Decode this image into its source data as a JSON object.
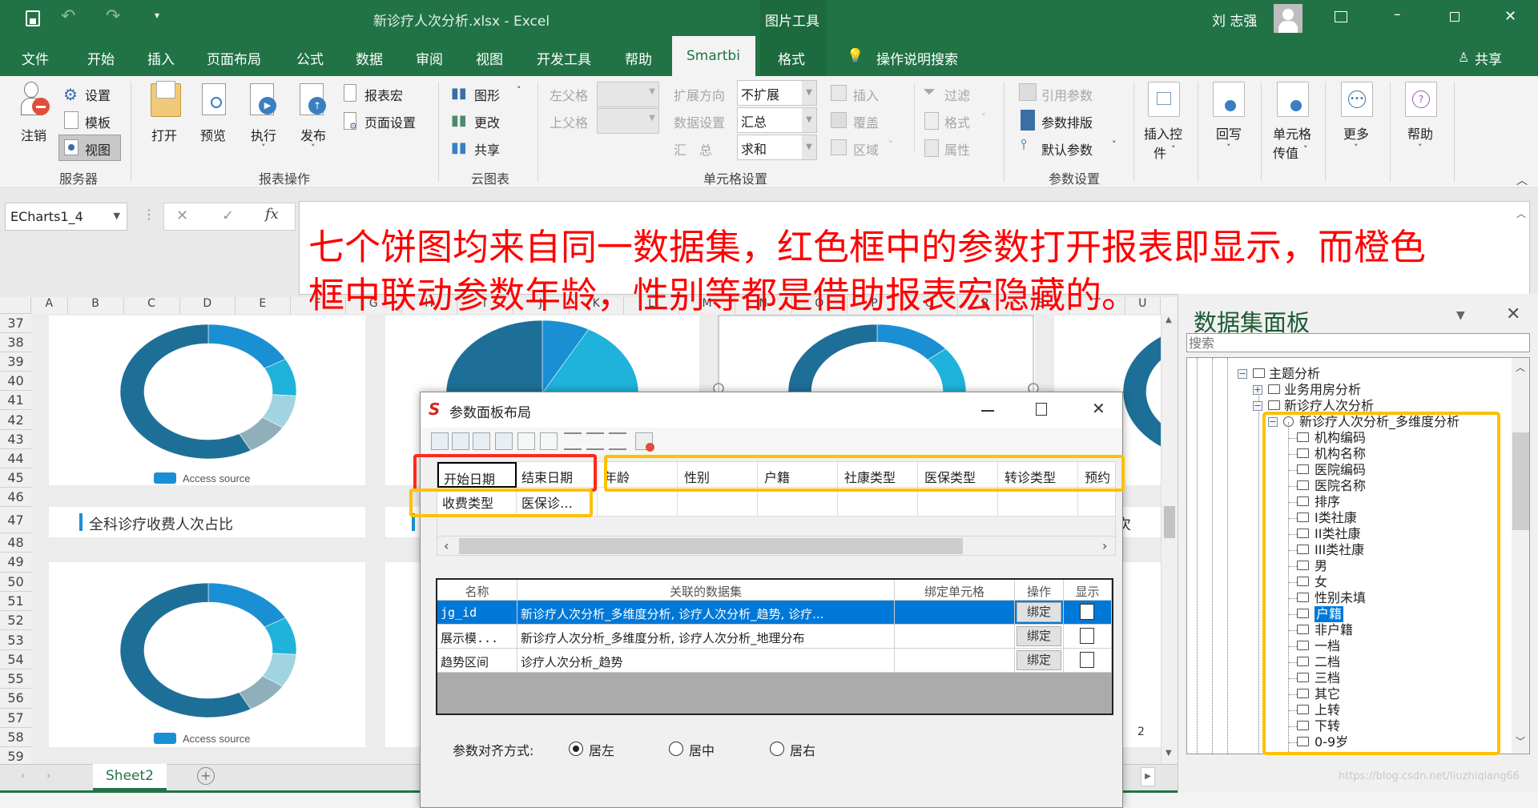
{
  "titlebar": {
    "title": "新诊疗人次分析.xlsx - Excel",
    "context_tool": "图片工具",
    "user": "刘 志强",
    "icons": [
      "save-icon",
      "undo-icon",
      "redo-icon",
      "customize-icon",
      "avatar",
      "ribbon-display-icon",
      "minimize-icon",
      "restore-icon",
      "close-icon"
    ]
  },
  "tabs": [
    "文件",
    "开始",
    "插入",
    "页面布局",
    "公式",
    "数据",
    "审阅",
    "视图",
    "开发工具",
    "帮助",
    "Smartbi",
    "格式"
  ],
  "active_tab": "Smartbi",
  "tell_me": "操作说明搜索",
  "share": "共享",
  "ribbon": {
    "server": {
      "logout": "注销",
      "settings": "设置",
      "template": "模板",
      "view": "视图",
      "label": "服务器"
    },
    "report_ops": {
      "open": "打开",
      "preview": "预览",
      "execute": "执行",
      "publish": "发布",
      "macro": "报表宏",
      "page_setup": "页面设置",
      "label": "报表操作"
    },
    "cloud_chart": {
      "chart": "图形",
      "change": "更改",
      "share": "共享",
      "label": "云图表"
    },
    "cell_settings": {
      "left_parent": "左父格",
      "top_parent": "上父格",
      "expand_dir": "扩展方向",
      "expand_dir_value": "不扩展",
      "data_setting": "数据设置",
      "data_setting_value": "汇总",
      "summary": "汇　总",
      "summary_value": "求和",
      "insert": "插入",
      "cover": "覆盖",
      "area": "区域",
      "filter": "过滤",
      "format": "格式",
      "property": "属性",
      "label": "单元格设置"
    },
    "param_settings": {
      "ref_param": "引用参数",
      "param_layout": "参数排版",
      "default_param": "默认参数",
      "label": "参数设置"
    },
    "insert_control": [
      "插入控",
      "件"
    ],
    "writeback": "回写",
    "cell_pass": [
      "单元格",
      "传值"
    ],
    "more": "更多",
    "help": "帮助"
  },
  "formula_bar": {
    "name_box": "ECharts1_4",
    "cancel": "✕",
    "enter": "✓",
    "fx": "fx"
  },
  "annotation": {
    "line1": "七个饼图均来自同一数据集，红色框中的参数打开报表即显示，而橙色",
    "line2": "框中联动参数年龄，性别等都是借助报表宏隐藏的。",
    "color": "#ff0000"
  },
  "sheet": {
    "columns": [
      "A",
      "B",
      "C",
      "D",
      "E",
      "F",
      "G",
      "H",
      "I",
      "J",
      "K",
      "L",
      "M",
      "N",
      "O",
      "P",
      "Q",
      "R",
      "S",
      "T",
      "U"
    ],
    "rows": [
      "37",
      "38",
      "39",
      "40",
      "41",
      "42",
      "43",
      "44",
      "45",
      "46",
      "47",
      "48",
      "49",
      "50",
      "51",
      "52",
      "53",
      "54",
      "55",
      "56",
      "57",
      "58",
      "59"
    ],
    "card_title_1": "全科诊疗收费人次占比",
    "card_title_4": "人次",
    "axis_tick": "2",
    "sheet_tab": "Sheet2"
  },
  "chart_data": [
    {
      "type": "pie",
      "style": "donut",
      "legend": [
        "Access source"
      ],
      "values": [
        17,
        9,
        8,
        8,
        58
      ]
    },
    {
      "type": "pie",
      "style": "pie",
      "values": [
        8,
        18,
        9,
        8,
        57
      ]
    },
    {
      "type": "pie",
      "style": "donut",
      "values": [
        14,
        12,
        9,
        8,
        57
      ]
    },
    {
      "type": "pie",
      "style": "donut",
      "values": [
        14,
        12,
        9,
        8,
        57
      ]
    },
    {
      "type": "pie",
      "style": "donut",
      "legend": [
        "Access source"
      ],
      "values": [
        17,
        9,
        8,
        8,
        58
      ]
    }
  ],
  "colors": {
    "excel_green": "#217346",
    "slices": [
      "#1a8fd3",
      "#1fb2da",
      "#9fd4e0",
      "#8fb0bb",
      "#1e6f98"
    ],
    "red_box": "#ff2a1a",
    "orange_box": "#ffc000",
    "selection_blue": "#0078d7"
  },
  "dialog": {
    "title": "参数面板布局",
    "toolbar_icons": [
      "insert-row-icon",
      "insert-column-icon",
      "move-left-icon",
      "move-right-icon",
      "align-bottom-icon",
      "align-center-icon",
      "align-left-icon",
      "align-middle-icon",
      "align-right-icon",
      "delete-icon"
    ],
    "grid_rows": [
      [
        "开始日期",
        "结束日期",
        "年龄",
        "性别",
        "户籍",
        "社康类型",
        "医保类型",
        "转诊类型",
        "预约"
      ],
      [
        "收费类型",
        "医保诊…",
        "",
        "",
        "",
        "",
        "",
        "",
        ""
      ]
    ],
    "table_headers": [
      "名称",
      "关联的数据集",
      "绑定单元格",
      "操作",
      "显示"
    ],
    "table_rows": [
      {
        "name": "jg_id",
        "datasets": "新诊疗人次分析_多维度分析, 诊疗人次分析_趋势, 诊疗...",
        "cell": "",
        "action": "绑定",
        "show": false
      },
      {
        "name": "展示模...",
        "datasets": "新诊疗人次分析_多维度分析, 诊疗人次分析_地理分布",
        "cell": "",
        "action": "绑定",
        "show": false
      },
      {
        "name": "趋势区间",
        "datasets": "诊疗人次分析_趋势",
        "cell": "",
        "action": "绑定",
        "show": false
      }
    ],
    "align_label": "参数对齐方式:",
    "align_options": [
      "居左",
      "居中",
      "居右"
    ],
    "align_selected": "居左"
  },
  "panel": {
    "title": "数据集面板",
    "search_placeholder": "搜索",
    "tree": [
      {
        "label": "主题分析",
        "type": "folder",
        "toggle": "minus",
        "level": 0
      },
      {
        "label": "业务用房分析",
        "type": "folder",
        "toggle": "plus",
        "level": 1
      },
      {
        "label": "新诊疗人次分析",
        "type": "folder",
        "toggle": "minus",
        "level": 1
      },
      {
        "label": "新诊疗人次分析_多维度分析",
        "type": "dataset",
        "toggle": "minus",
        "level": 2
      },
      {
        "label": "机构编码",
        "type": "field",
        "level": 3
      },
      {
        "label": "机构名称",
        "type": "field",
        "level": 3
      },
      {
        "label": "医院编码",
        "type": "field",
        "level": 3
      },
      {
        "label": "医院名称",
        "type": "field",
        "level": 3
      },
      {
        "label": "排序",
        "type": "field",
        "level": 3
      },
      {
        "label": "I类社康",
        "type": "field",
        "level": 3
      },
      {
        "label": "II类社康",
        "type": "field",
        "level": 3
      },
      {
        "label": "III类社康",
        "type": "field",
        "level": 3
      },
      {
        "label": "男",
        "type": "field",
        "level": 3
      },
      {
        "label": "女",
        "type": "field",
        "level": 3
      },
      {
        "label": "性别未填",
        "type": "field",
        "level": 3
      },
      {
        "label": "户籍",
        "type": "field",
        "level": 3,
        "selected": true
      },
      {
        "label": "非户籍",
        "type": "field",
        "level": 3
      },
      {
        "label": "一档",
        "type": "field",
        "level": 3
      },
      {
        "label": "二档",
        "type": "field",
        "level": 3
      },
      {
        "label": "三档",
        "type": "field",
        "level": 3
      },
      {
        "label": "其它",
        "type": "field",
        "level": 3
      },
      {
        "label": "上转",
        "type": "field",
        "level": 3
      },
      {
        "label": "下转",
        "type": "field",
        "level": 3
      },
      {
        "label": "0-9岁",
        "type": "field",
        "level": 3
      }
    ]
  },
  "watermark": "https://blog.csdn.net/liuzhiqiang66"
}
